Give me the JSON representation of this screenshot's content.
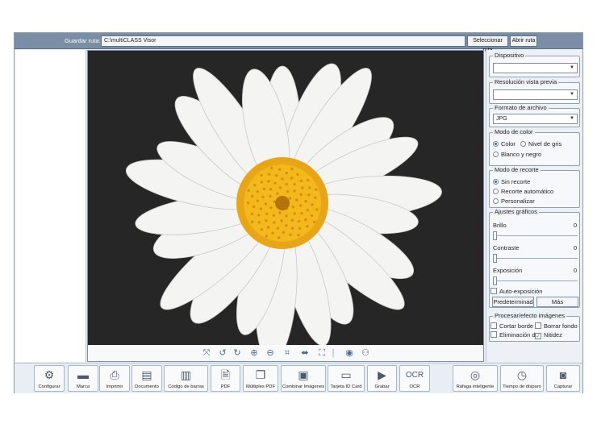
{
  "path_bar": {
    "label": "Guardar ruta:",
    "path": "C:\\multiCLASS Visor",
    "select_btn": "Seleccionar ruta",
    "open_btn": "Abrir ruta"
  },
  "settings": {
    "device": {
      "title": "Dispositivo",
      "value": ""
    },
    "resolution": {
      "title": "Resolución vista previa",
      "value": ""
    },
    "format": {
      "title": "Formato de archivo",
      "value": "JPG"
    },
    "color_mode": {
      "title": "Modo de color",
      "options": [
        "Color",
        "Nivel de gris",
        "Blanco y negro"
      ],
      "selected": "Color"
    },
    "crop_mode": {
      "title": "Modo de recorte",
      "options": [
        "Sin recorte",
        "Recorte automático",
        "Personalizar"
      ],
      "selected": "Sin recorte"
    },
    "graphics": {
      "title": "Ajustes gráficos",
      "brightness_label": "Brillo",
      "brightness_value": "0",
      "contrast_label": "Contraste",
      "contrast_value": "0",
      "exposure_label": "Exposición",
      "exposure_value": "0",
      "auto_exposure": "Auto-exposición",
      "default_btn": "Predeterminad",
      "more_btn": "Más"
    },
    "processing": {
      "title": "Procesar/efecto imágenes",
      "cut_edge": "Cortar borde",
      "erase_bg": "Borrar fondo",
      "remove": "Eliminación d",
      "sharpness": "Nitidez"
    }
  },
  "toolbar": {
    "configurar": "Configurar",
    "marca": "Marca",
    "imprimir": "Imprimir",
    "documento": "Documento",
    "barcode": "Código de barras",
    "pdf": "PDF",
    "multi_pdf": "Múltiples PDF",
    "combine": "Combinar Imágenes",
    "id_card": "Tarjeta ID Card",
    "record": "Grabar",
    "ocr": "OCR",
    "ocr_icon_text": "OCR",
    "burst": "Ráfaga inteligente",
    "timer": "Tiempo de disparo",
    "capture": "Capturar"
  }
}
